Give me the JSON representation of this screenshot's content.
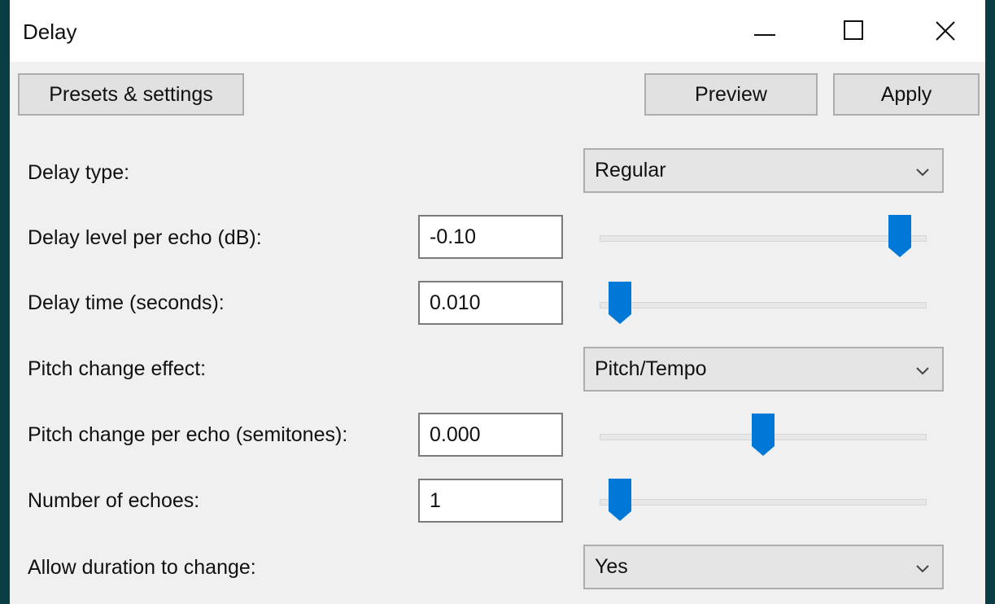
{
  "window": {
    "title": "Delay"
  },
  "toolbar": {
    "presets_label": "Presets & settings",
    "preview_label": "Preview",
    "apply_label": "Apply"
  },
  "fields": {
    "delay_type": {
      "label": "Delay type:",
      "value": "Regular"
    },
    "delay_level": {
      "label": "Delay level per echo (dB):",
      "value": "-0.10",
      "slider_fraction": 0.95
    },
    "delay_time": {
      "label": "Delay time (seconds):",
      "value": "0.010",
      "slider_fraction": 0.03
    },
    "pitch_effect": {
      "label": "Pitch change effect:",
      "value": "Pitch/Tempo"
    },
    "pitch_change": {
      "label": "Pitch change per echo (semitones):",
      "value": "0.000",
      "slider_fraction": 0.5
    },
    "echoes": {
      "label": "Number of echoes:",
      "value": "1",
      "slider_fraction": 0.03
    },
    "allow_duration": {
      "label": "Allow duration to change:",
      "value": "Yes"
    }
  },
  "colors": {
    "slider_thumb": "#0078d7",
    "desktop": "#0a3d44"
  }
}
